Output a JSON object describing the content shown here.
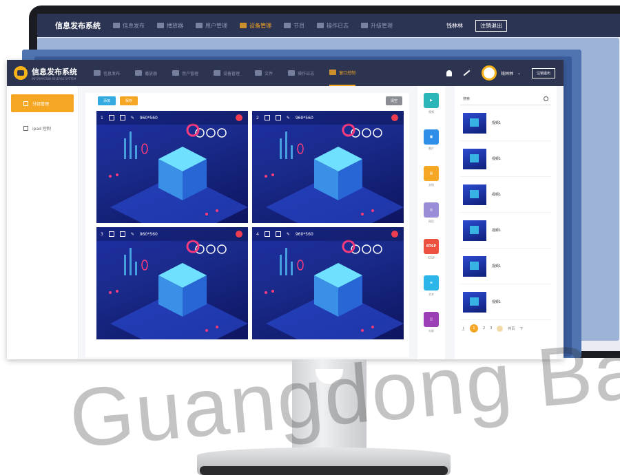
{
  "brand": {
    "name": "信息发布系统",
    "subtitle": "INFORMATION RELEASE SYSTEM",
    "accent": "#f5a623",
    "navy": "#2d3450"
  },
  "back_screen": {
    "title": "信息发布系统",
    "nav": [
      "信息发布",
      "播放器",
      "用户管理",
      "设备管理",
      "节目",
      "操作日志",
      "升级管理"
    ],
    "active_nav_index": 3,
    "user": "钱林林",
    "exit": "注销退出"
  },
  "topbar": {
    "nav": [
      {
        "label": "信息发布",
        "icon": "monitor-icon"
      },
      {
        "label": "播放器",
        "icon": "player-icon"
      },
      {
        "label": "用户管理",
        "icon": "user-icon"
      },
      {
        "label": "设备管理",
        "icon": "device-icon"
      },
      {
        "label": "文件",
        "icon": "file-icon"
      },
      {
        "label": "操作日志",
        "icon": "log-icon"
      },
      {
        "label": "窗口控制",
        "icon": "window-control-icon",
        "active": true
      }
    ],
    "user_name": "钱林林",
    "exit_button": "注销退出"
  },
  "sidebar": {
    "items": [
      {
        "label": "分组管理",
        "active": true
      },
      {
        "label": "ipad 控制",
        "active": false
      }
    ]
  },
  "panel": {
    "buttons": {
      "add": "添加",
      "save": "保存",
      "reset": "清空"
    },
    "tiles": [
      {
        "index": "1",
        "size": "960*560"
      },
      {
        "index": "2",
        "size": "960*560"
      },
      {
        "index": "3",
        "size": "960*560"
      },
      {
        "index": "4",
        "size": "960*560"
      }
    ]
  },
  "tools": [
    {
      "label": "视频",
      "color": "#2ab6b8",
      "glyph": "▶",
      "icon": "video-icon"
    },
    {
      "label": "图片",
      "color": "#2f8ee8",
      "glyph": "▣",
      "icon": "image-icon"
    },
    {
      "label": "文档",
      "color": "#f5a623",
      "glyph": "▤",
      "icon": "document-icon"
    },
    {
      "label": "网页",
      "color": "#9b8cd8",
      "glyph": "◎",
      "icon": "web-icon"
    },
    {
      "label": "RTSP",
      "color": "#ee5040",
      "glyph": "RTSP",
      "icon": "rtsp-icon"
    },
    {
      "label": "文本",
      "color": "#2bb5e8",
      "glyph": "≡",
      "icon": "text-icon"
    },
    {
      "label": "分屏",
      "color": "#9c3fb6",
      "glyph": "◫",
      "icon": "split-screen-icon"
    }
  ],
  "library": {
    "search_placeholder": "搜索",
    "items": [
      "视频1",
      "视频1",
      "视频1",
      "视频1",
      "视频1",
      "视频1"
    ],
    "pager": {
      "prev": "上",
      "current": "1",
      "pages": [
        "2",
        "3"
      ],
      "total": "共页",
      "next": "下"
    }
  },
  "watermark": "Guangdong Bao"
}
